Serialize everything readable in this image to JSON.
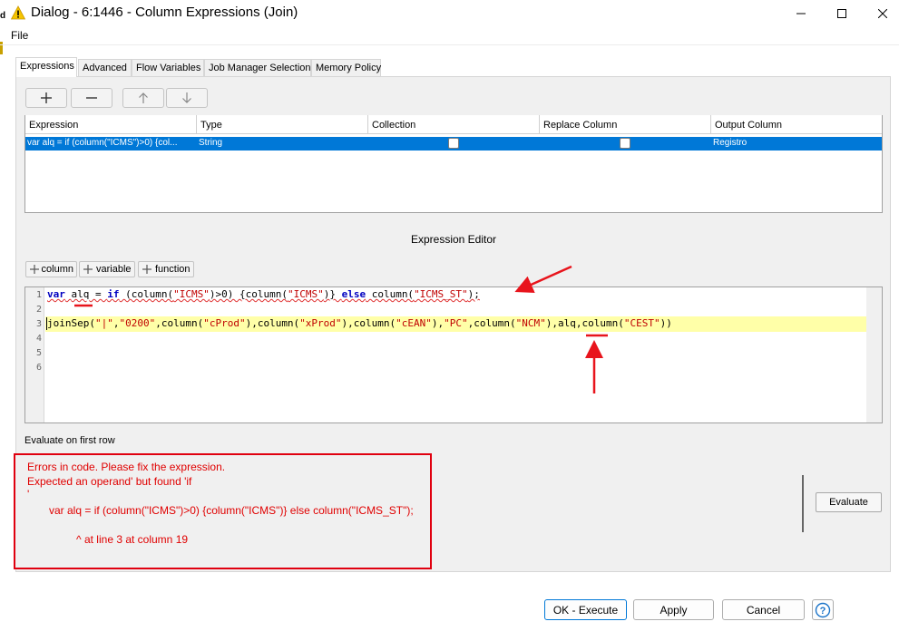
{
  "window": {
    "title": "Dialog - 6:1446 - Column Expressions (Join)",
    "warning_icon_color": "#f5c400"
  },
  "menu": {
    "file": "File"
  },
  "left_edge": {
    "text": "d"
  },
  "tabs": [
    {
      "label": "Expressions",
      "active": true
    },
    {
      "label": "Advanced"
    },
    {
      "label": "Flow Variables"
    },
    {
      "label": "Job Manager Selection"
    },
    {
      "label": "Memory Policy"
    }
  ],
  "toolbar": {
    "add": "+",
    "remove": "−",
    "up": "↑",
    "down": "↓"
  },
  "table": {
    "headers": [
      "Expression",
      "Type",
      "Collection",
      "Replace Column",
      "Output Column"
    ],
    "rows": [
      {
        "expression": "var alq = if (column(\"ICMS\")>0) {col...",
        "type": "String",
        "collection": false,
        "replace_column": false,
        "output_column": "Registro"
      }
    ],
    "selection_color": "#0078d7"
  },
  "editor": {
    "title": "Expression Editor",
    "buttons": {
      "column": "column",
      "variable": "variable",
      "function": "function"
    },
    "line_numbers": [
      "1",
      "2",
      "3",
      "4",
      "5",
      "6"
    ],
    "line1": {
      "kw_var": "var",
      "name": "alq",
      "eq": " = ",
      "kw_if": "if",
      "p1": " (column(",
      "s1": "\"ICMS\"",
      "p2": ")>0) {column(",
      "s2": "\"ICMS\"",
      "p3": ")} ",
      "kw_else": "else",
      "p4": " column(",
      "s3": "\"ICMS_ST\"",
      "p5": ");"
    },
    "line3": {
      "fn": "joinSep(",
      "s1": "\"|\"",
      "c1": ",",
      "s2": "\"0200\"",
      "c2": ",column(",
      "s3": "\"cProd\"",
      "c3": "),column(",
      "s4": "\"xProd\"",
      "c4": "),column(",
      "s5": "\"cEAN\"",
      "c5": "),",
      "s6": "\"PC\"",
      "c6": ",column(",
      "s7": "\"NCM\"",
      "c7": "),alq,column(",
      "s8": "\"CEST\"",
      "c8": "))"
    }
  },
  "evaluate": {
    "label": "Evaluate on first row",
    "button": "Evaluate"
  },
  "error": {
    "line1": "Errors in code. Please fix the expression.",
    "line2": "Expected an operand' but found 'if",
    "line3": "'",
    "line4": "var alq = if (column(\"ICMS\")>0) {column(\"ICMS\")} else column(\"ICMS_ST\");",
    "line5": "^ at line 3 at column 19",
    "color": "#e00000"
  },
  "footer": {
    "ok": "OK - Execute",
    "apply": "Apply",
    "cancel": "Cancel",
    "help": "?"
  },
  "annotation_color": "#e8141c"
}
